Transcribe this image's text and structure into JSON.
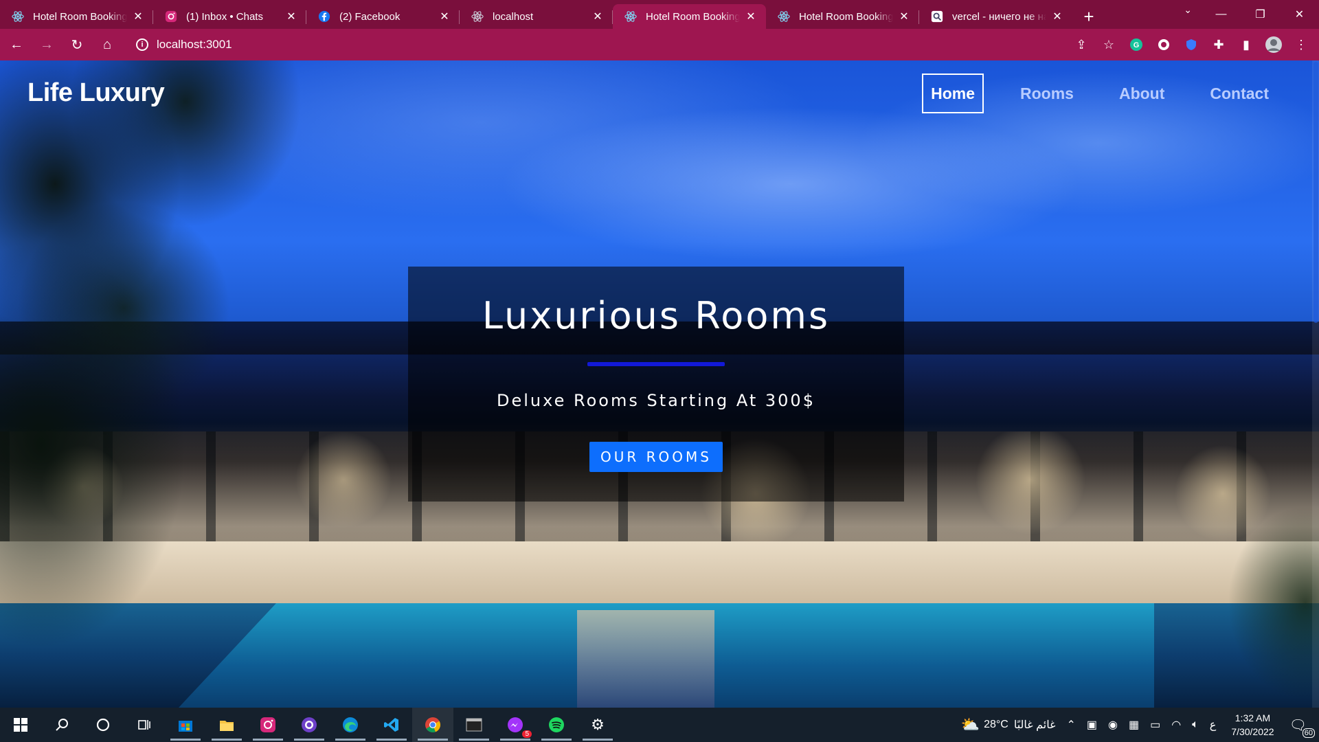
{
  "browser": {
    "tabs": [
      {
        "title": "Hotel Room Booking",
        "icon": "react-icon",
        "active": false
      },
      {
        "title": "(1) Inbox • Chats",
        "icon": "instagram-icon",
        "active": false
      },
      {
        "title": "(2) Facebook",
        "icon": "facebook-icon",
        "active": false
      },
      {
        "title": "localhost",
        "icon": "react-icon",
        "active": false
      },
      {
        "title": "Hotel Room Booking",
        "icon": "react-icon",
        "active": true
      },
      {
        "title": "Hotel Room Booking",
        "icon": "react-icon",
        "active": false
      },
      {
        "title": "vercel - ничего не на",
        "icon": "search-icon",
        "active": false
      }
    ],
    "url": "localhost:3001",
    "accent": "#9e1650",
    "tabbar_color": "#7a0f3c"
  },
  "page": {
    "brand": "Life Luxury",
    "nav": {
      "home": "Home",
      "rooms": "Rooms",
      "about": "About",
      "contact": "Contact",
      "active": "Home"
    },
    "hero": {
      "title": "Luxurious Rooms",
      "subtitle": "Deluxe Rooms Starting At 300$",
      "cta": "OUR ROOMS",
      "underline_color": "#1219d8",
      "cta_color": "#0d6efd"
    }
  },
  "taskbar": {
    "weather": "28°C",
    "weather_text": "غائم غالبًا",
    "lang": "ع",
    "time": "1:32 AM",
    "date": "7/30/2022",
    "notifications": "60",
    "opera_badge": "5"
  }
}
